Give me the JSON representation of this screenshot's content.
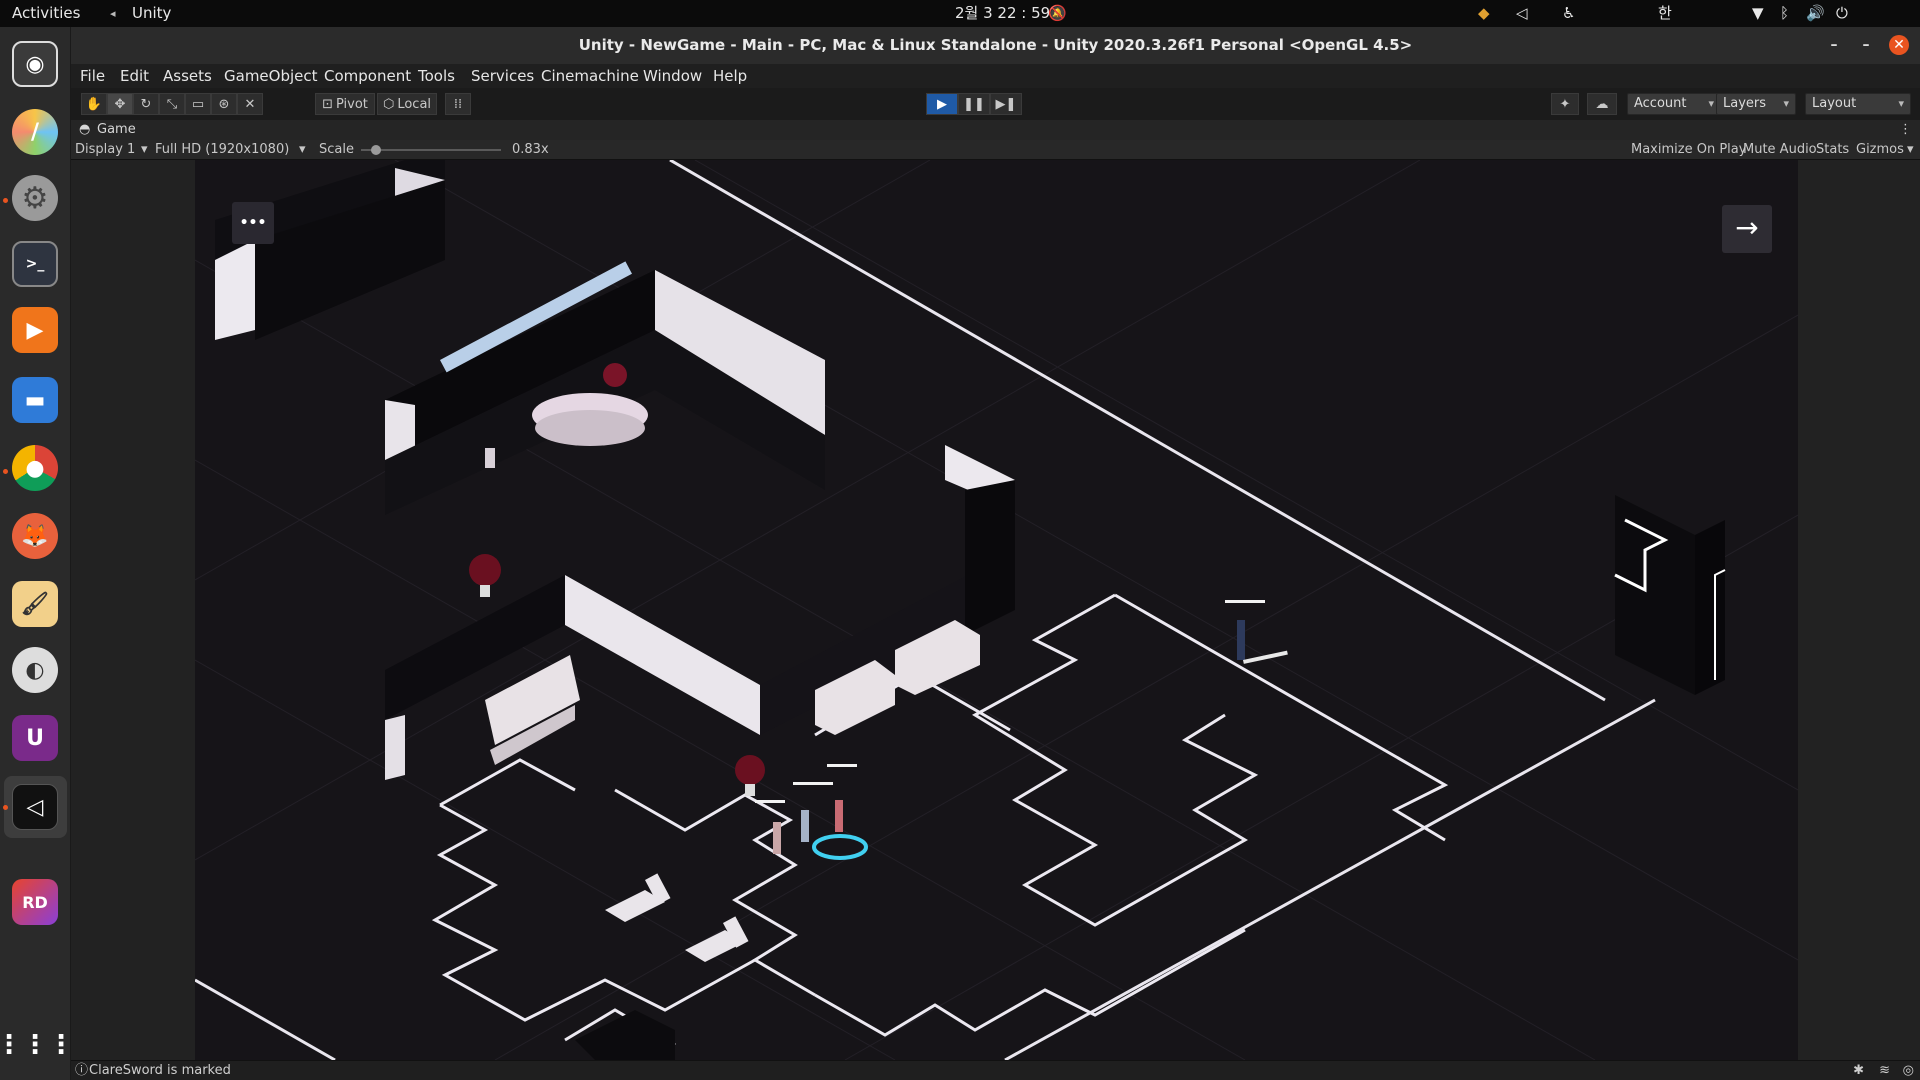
{
  "topbar": {
    "activities": "Activities",
    "app_name": "Unity",
    "clock": "2월 3  22 : 59",
    "ime": "한"
  },
  "window": {
    "title": "Unity - NewGame - Main - PC, Mac & Linux Standalone - Unity 2020.3.26f1 Personal <OpenGL 4.5>",
    "minimize": "–",
    "maximize": "–",
    "close": "✕"
  },
  "menu": [
    "File",
    "Edit",
    "Assets",
    "GameObject",
    "Component",
    "Tools",
    "Services",
    "Cinemachine",
    "Window",
    "Help"
  ],
  "toolbar": {
    "pivot": "Pivot",
    "local": "Local",
    "account": "Account",
    "layers": "Layers",
    "layout": "Layout"
  },
  "game_view": {
    "tab_label": "Game",
    "display": "Display 1",
    "resolution": "Full HD (1920x1080)",
    "scale_label": "Scale",
    "scale_value": "0.83x",
    "scale_fraction": 0.08,
    "maximize_on_play": "Maximize On Play",
    "mute_audio": "Mute Audio",
    "stats": "Stats",
    "gizmos": "Gizmos"
  },
  "scene_ui": {
    "menu_button": "•••",
    "next_button": "→"
  },
  "status": {
    "message": "ClareSword is marked"
  },
  "colors": {
    "accent_orange": "#e95420",
    "play_active": "#1f5aa6",
    "scene_floor": "#161418",
    "scene_lines": "#e9e6ee"
  },
  "icons": {
    "dock": [
      "screenshot-icon",
      "color-picker-icon",
      "settings-icon",
      "terminal-icon",
      "media-player-icon",
      "files-icon",
      "chrome-icon",
      "firefox-icon",
      "paint-icon",
      "inkscape-icon",
      "ubuntu-software-icon",
      "unity-icon",
      "rider-icon",
      "apps-grid-icon"
    ]
  }
}
